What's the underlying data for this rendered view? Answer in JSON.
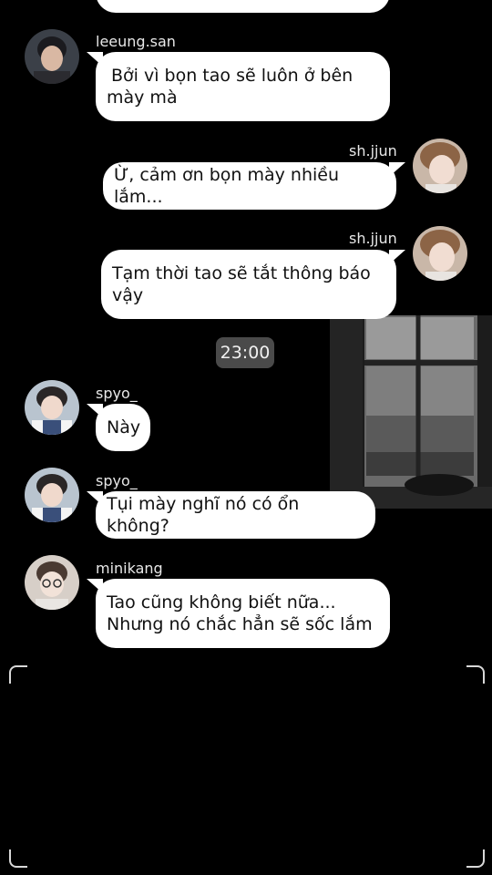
{
  "time_separator": "23:00",
  "messages": [
    {
      "sender": "",
      "text": ""
    },
    {
      "sender": "leeung.san",
      "text_lines": [
        "Bởi vì bọn tao sẽ luôn ở bên",
        "mày mà"
      ]
    },
    {
      "sender": "sh.jjun",
      "text": "Ừ, cảm ơn bọn mày nhiều lắm..."
    },
    {
      "sender": "sh.jjun",
      "text_lines": [
        "Tạm thời tao sẽ tắt thông báo",
        "vậy"
      ]
    },
    {
      "sender": "spyo_",
      "text": "Này"
    },
    {
      "sender": "spyo_",
      "text": "Tụi mày nghĩ nó có ổn không?"
    },
    {
      "sender": "minikang",
      "text_lines": [
        "Tao cũng không biết nữa...",
        "Nhưng nó chắc hẳn sẽ sốc lắm"
      ]
    }
  ],
  "colors": {
    "background": "#000000",
    "bubble": "#ffffff",
    "time_badge": "#4a4a4a"
  },
  "icons": {
    "avatar": "profile-photo",
    "frame": "camera-frame-corners"
  }
}
